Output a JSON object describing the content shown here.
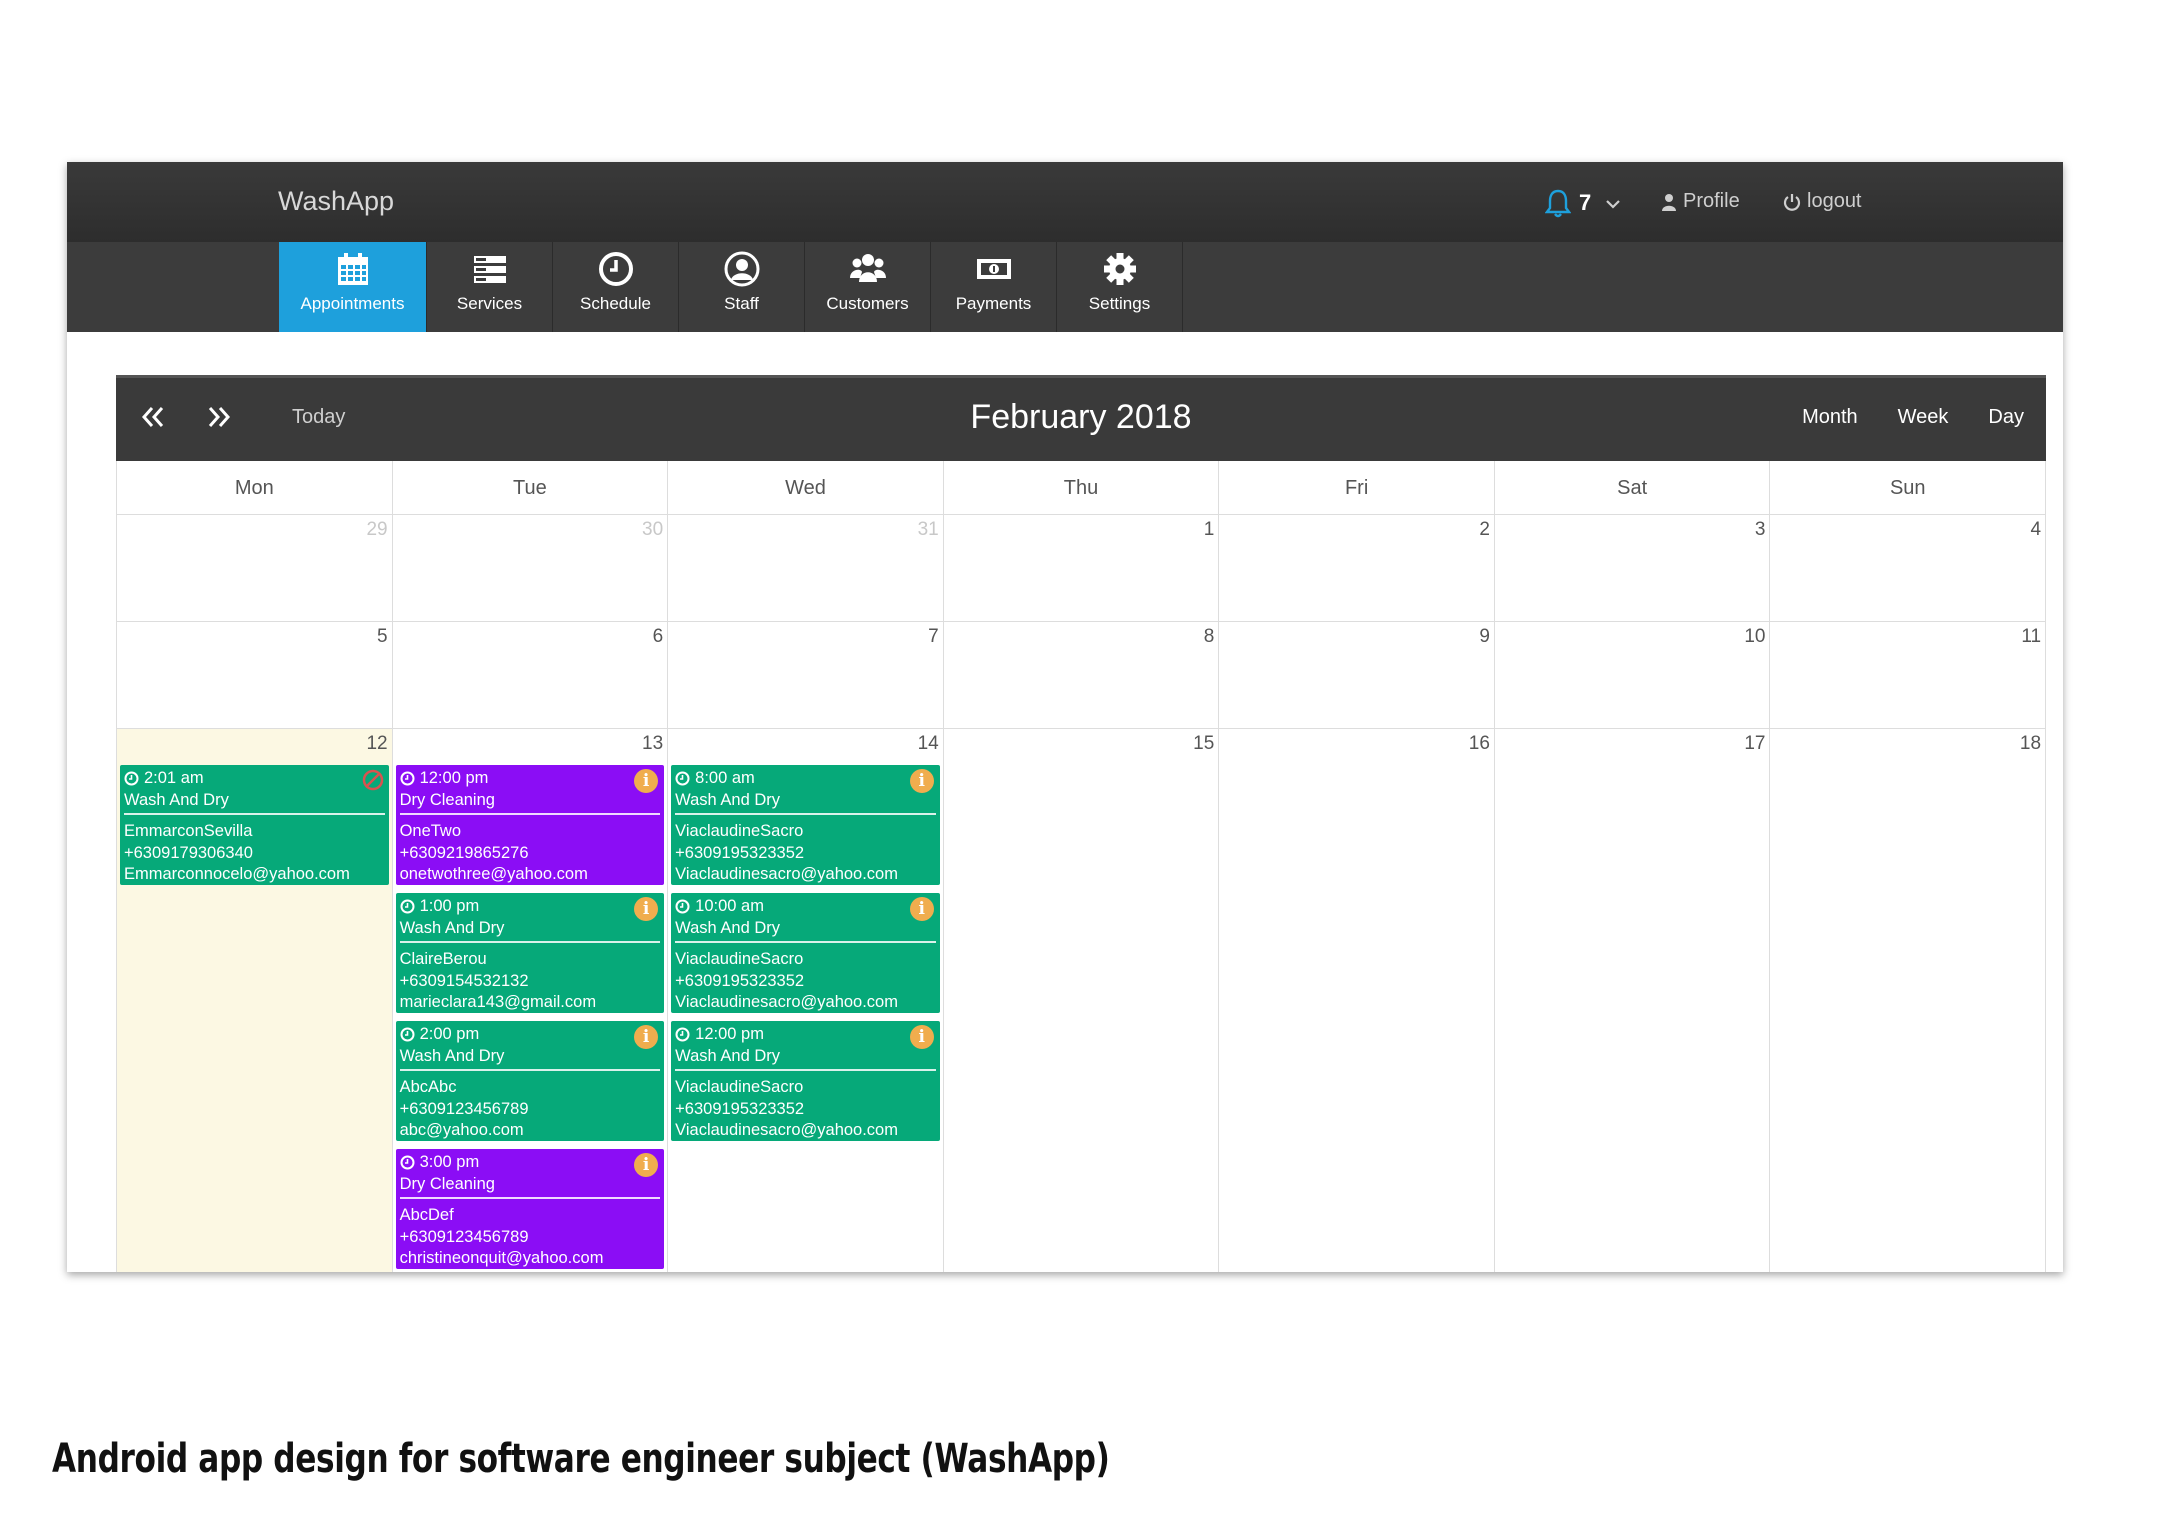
{
  "app": {
    "title": "WashApp",
    "notifications_count": "7",
    "profile_label": "Profile",
    "logout_label": "logout",
    "accent_color": "#1ea0dc"
  },
  "nav": [
    {
      "label": "Appointments",
      "icon": "calendar-icon",
      "active": true
    },
    {
      "label": "Services",
      "icon": "list-icon",
      "active": false
    },
    {
      "label": "Schedule",
      "icon": "clock-icon",
      "active": false
    },
    {
      "label": "Staff",
      "icon": "user-circle-icon",
      "active": false
    },
    {
      "label": "Customers",
      "icon": "users-icon",
      "active": false
    },
    {
      "label": "Payments",
      "icon": "money-icon",
      "active": false
    },
    {
      "label": "Settings",
      "icon": "gear-icon",
      "active": false
    }
  ],
  "calendar": {
    "title": "February 2018",
    "today_label": "Today",
    "views": [
      "Month",
      "Week",
      "Day"
    ],
    "days_of_week": [
      "Mon",
      "Tue",
      "Wed",
      "Thu",
      "Fri",
      "Sat",
      "Sun"
    ],
    "weeks": [
      [
        "29",
        "30",
        "31",
        "1",
        "2",
        "3",
        "4"
      ],
      [
        "5",
        "6",
        "7",
        "8",
        "9",
        "10",
        "11"
      ],
      [
        "12",
        "13",
        "14",
        "15",
        "16",
        "17",
        "18"
      ]
    ],
    "events": {
      "mon": [
        {
          "time": "2:01 am",
          "service": "Wash And Dry",
          "name": "EmmarconSevilla",
          "phone": "+6309179306340",
          "email": "Emmarconnocelo@yahoo.com",
          "color": "#06a979",
          "status_icon": "cancel-icon"
        }
      ],
      "tue": [
        {
          "time": "12:00 pm",
          "service": "Dry Cleaning",
          "name": "OneTwo",
          "phone": "+6309219865276",
          "email": "onetwothree@yahoo.com",
          "color": "#8b0df5",
          "status_icon": "info-icon"
        },
        {
          "time": "1:00 pm",
          "service": "Wash And Dry",
          "name": "ClaireBerou",
          "phone": "+6309154532132",
          "email": "marieclara143@gmail.com",
          "color": "#06a979",
          "status_icon": "info-icon"
        },
        {
          "time": "2:00 pm",
          "service": "Wash And Dry",
          "name": "AbcAbc",
          "phone": "+6309123456789",
          "email": "abc@yahoo.com",
          "color": "#06a979",
          "status_icon": "info-icon"
        },
        {
          "time": "3:00 pm",
          "service": "Dry Cleaning",
          "name": "AbcDef",
          "phone": "+6309123456789",
          "email": "christineonquit@yahoo.com",
          "color": "#8b0df5",
          "status_icon": "info-icon"
        }
      ],
      "wed": [
        {
          "time": "8:00 am",
          "service": "Wash And Dry",
          "name": "ViaclaudineSacro",
          "phone": "+6309195323352",
          "email": "Viaclaudinesacro@yahoo.com",
          "color": "#06a979",
          "status_icon": "info-icon"
        },
        {
          "time": "10:00 am",
          "service": "Wash And Dry",
          "name": "ViaclaudineSacro",
          "phone": "+6309195323352",
          "email": "Viaclaudinesacro@yahoo.com",
          "color": "#06a979",
          "status_icon": "info-icon"
        },
        {
          "time": "12:00 pm",
          "service": "Wash And Dry",
          "name": "ViaclaudineSacro",
          "phone": "+6309195323352",
          "email": "Viaclaudinesacro@yahoo.com",
          "color": "#06a979",
          "status_icon": "info-icon"
        }
      ]
    }
  },
  "caption": "Android app design for software engineer subject (WashApp)"
}
